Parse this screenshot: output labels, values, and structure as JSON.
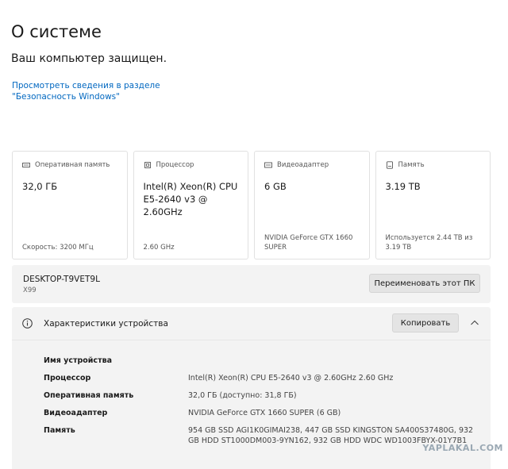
{
  "page": {
    "title": "О системе",
    "subtitle": "Ваш компьютер защищен.",
    "security_link": "Просмотреть сведения в разделе \"Безопасность Windows\""
  },
  "cards": [
    {
      "icon": "ram-icon",
      "label": "Оперативная память",
      "value": "32,0 ГБ",
      "foot": "Скорость: 3200 МГц"
    },
    {
      "icon": "cpu-icon",
      "label": "Процессор",
      "value": "Intel(R) Xeon(R) CPU E5-2640 v3 @ 2.60GHz",
      "foot": "2.60 GHz"
    },
    {
      "icon": "gpu-icon",
      "label": "Видеоадаптер",
      "value": "6 GB",
      "foot": "NVIDIA GeForce GTX 1660 SUPER"
    },
    {
      "icon": "storage-icon",
      "label": "Память",
      "value": "3.19 TB",
      "foot": "Используется 2.44 TB из 3.19 TB"
    }
  ],
  "device": {
    "name": "DESKTOP-T9VET9L",
    "model": "X99",
    "rename_label": "Переименовать этот ПК"
  },
  "specs": {
    "title": "Характеристики устройства",
    "copy_label": "Копировать",
    "rows": [
      {
        "label": "Имя устройства",
        "value": ""
      },
      {
        "label": "Процессор",
        "value": "Intel(R) Xeon(R) CPU E5-2640 v3 @ 2.60GHz   2.60 GHz"
      },
      {
        "label": "Оперативная память",
        "value": "32,0 ГБ (доступно: 31,8 ГБ)"
      },
      {
        "label": "Видеоадаптер",
        "value": "NVIDIA GeForce GTX 1660 SUPER (6 GB)"
      },
      {
        "label": "Память",
        "value": "954 GB SSD AGI1K0GIMAI238, 447 GB SSD KINGSTON SA400S37480G, 932 GB HDD ST1000DM003-9YN162, 932 GB HDD WDC WD1003FBYX-01Y7B1"
      }
    ]
  },
  "watermark": "YAPLAKAL.COM"
}
